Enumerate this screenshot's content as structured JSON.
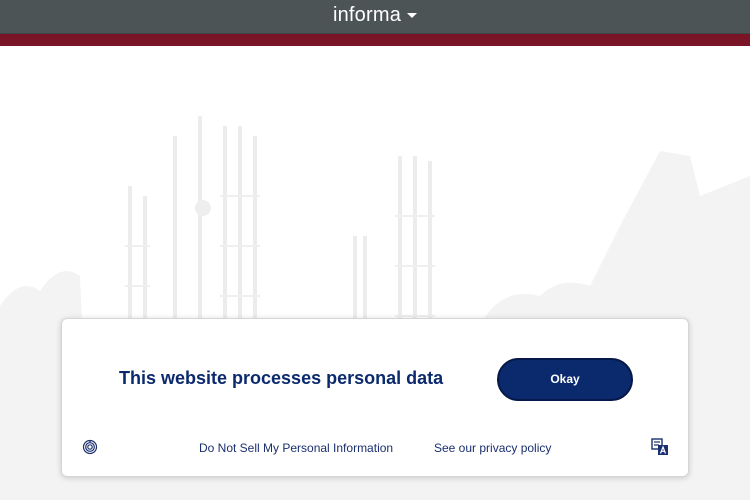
{
  "header": {
    "brand": "informa",
    "brand_caret_icon": "caret-down-icon"
  },
  "background": {
    "scene_icon": "construction-silhouette"
  },
  "consent_banner": {
    "title": "This website processes personal data",
    "okay_label": "Okay",
    "do_not_sell_label": "Do Not Sell My Personal Information",
    "privacy_label": "See our privacy policy",
    "fingerprint_icon": "fingerprint-icon",
    "translate_icon": "translate-icon"
  },
  "colors": {
    "header_bg": "#4d5456",
    "accent_stripe": "#7a1528",
    "primary": "#0b2a6d"
  }
}
